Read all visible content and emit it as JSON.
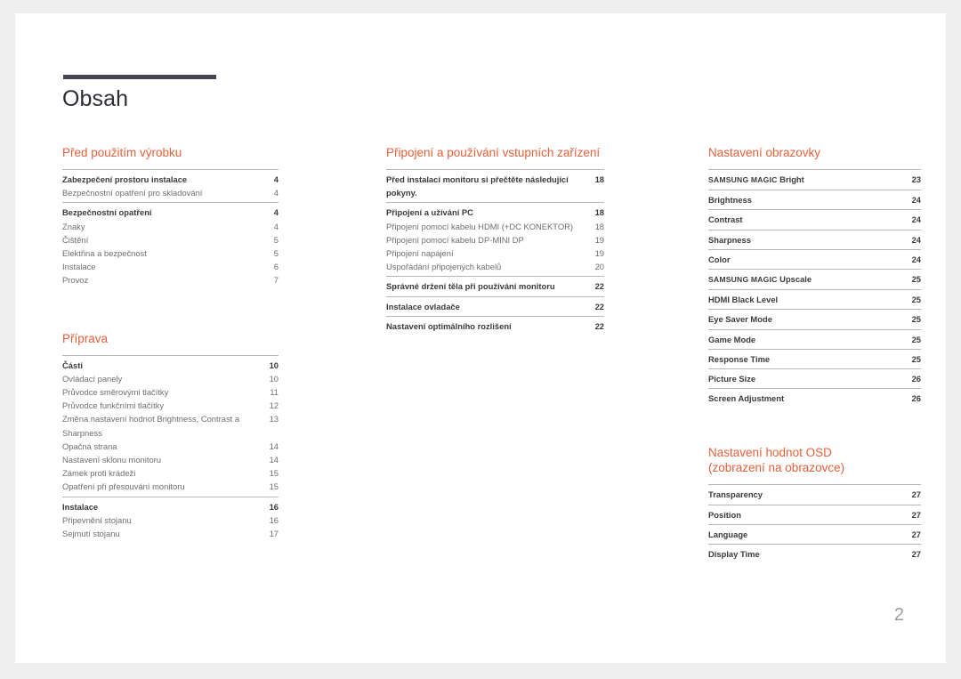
{
  "document": {
    "title": "Obsah",
    "page_number": "2",
    "accent_color": "#e4603c",
    "title_rule_color": "#474451"
  },
  "columns": [
    {
      "name": "column-left",
      "sections": [
        {
          "heading": "Před použitím výrobku",
          "groups": [
            {
              "entries": [
                {
                  "label": "Zabezpečení prostoru instalace",
                  "page": "4",
                  "level": "main"
                },
                {
                  "label": "Bezpečnostní opatření pro skladování",
                  "page": "4",
                  "level": "sub"
                }
              ]
            },
            {
              "entries": [
                {
                  "label": "Bezpečnostní opatření",
                  "page": "4",
                  "level": "main"
                },
                {
                  "label": "Znaky",
                  "page": "4",
                  "level": "sub"
                },
                {
                  "label": "Čištění",
                  "page": "5",
                  "level": "sub"
                },
                {
                  "label": "Elektřina a bezpečnost",
                  "page": "5",
                  "level": "sub"
                },
                {
                  "label": "Instalace",
                  "page": "6",
                  "level": "sub"
                },
                {
                  "label": "Provoz",
                  "page": "7",
                  "level": "sub"
                }
              ]
            }
          ]
        },
        {
          "heading": "Příprava",
          "groups": [
            {
              "entries": [
                {
                  "label": "Části",
                  "page": "10",
                  "level": "main"
                },
                {
                  "label": "Ovládací panely",
                  "page": "10",
                  "level": "sub"
                },
                {
                  "label": "Průvodce směrovými tlačítky",
                  "page": "11",
                  "level": "sub"
                },
                {
                  "label": "Průvodce funkčními tlačítky",
                  "page": "12",
                  "level": "sub"
                },
                {
                  "label": "Změna nastavení hodnot Brightness, Contrast a Sharpness",
                  "page": "13",
                  "level": "sub"
                },
                {
                  "label": "Opačná strana",
                  "page": "14",
                  "level": "sub"
                },
                {
                  "label": "Nastavení sklonu monitoru",
                  "page": "14",
                  "level": "sub"
                },
                {
                  "label": "Zámek proti krádeži",
                  "page": "15",
                  "level": "sub"
                },
                {
                  "label": "Opatření při přesouvání monitoru",
                  "page": "15",
                  "level": "sub"
                }
              ]
            },
            {
              "entries": [
                {
                  "label": "Instalace",
                  "page": "16",
                  "level": "main"
                },
                {
                  "label": "Připevnění stojanu",
                  "page": "16",
                  "level": "sub"
                },
                {
                  "label": "Sejmutí stojanu",
                  "page": "17",
                  "level": "sub"
                }
              ]
            }
          ]
        }
      ]
    },
    {
      "name": "column-middle",
      "sections": [
        {
          "heading": "Připojení a používání vstupních zařízení",
          "groups": [
            {
              "entries": [
                {
                  "label": "Před instalací monitoru si přečtěte následující pokyny.",
                  "page": "18",
                  "level": "main"
                }
              ]
            },
            {
              "entries": [
                {
                  "label": "Připojení a užívání PC",
                  "page": "18",
                  "level": "main"
                },
                {
                  "label": "Připojení pomocí kabelu HDMI (+DC KONEKTOR)",
                  "page": "18",
                  "level": "sub"
                },
                {
                  "label": "Připojení pomocí kabelu DP-MINI DP",
                  "page": "19",
                  "level": "sub"
                },
                {
                  "label": "Připojení napájení",
                  "page": "19",
                  "level": "sub"
                },
                {
                  "label": "Uspořádání připojených kabelů",
                  "page": "20",
                  "level": "sub"
                }
              ]
            },
            {
              "entries": [
                {
                  "label": "Správné držení těla při používání monitoru",
                  "page": "22",
                  "level": "main"
                }
              ]
            },
            {
              "entries": [
                {
                  "label": "Instalace ovladače",
                  "page": "22",
                  "level": "main"
                }
              ]
            },
            {
              "entries": [
                {
                  "label": "Nastavení optimálního rozlišení",
                  "page": "22",
                  "level": "main"
                }
              ]
            }
          ]
        }
      ]
    },
    {
      "name": "column-right",
      "sections": [
        {
          "heading": "Nastavení obrazovky",
          "groups": [
            {
              "entries": [
                {
                  "label": "SAMSUNG MAGIC Bright",
                  "page": "23",
                  "level": "main"
                }
              ]
            },
            {
              "entries": [
                {
                  "label": "Brightness",
                  "page": "24",
                  "level": "main"
                }
              ]
            },
            {
              "entries": [
                {
                  "label": "Contrast",
                  "page": "24",
                  "level": "main"
                }
              ]
            },
            {
              "entries": [
                {
                  "label": "Sharpness",
                  "page": "24",
                  "level": "main"
                }
              ]
            },
            {
              "entries": [
                {
                  "label": "Color",
                  "page": "24",
                  "level": "main"
                }
              ]
            },
            {
              "entries": [
                {
                  "label": "SAMSUNG MAGIC Upscale",
                  "page": "25",
                  "level": "main"
                }
              ]
            },
            {
              "entries": [
                {
                  "label": "HDMI Black Level",
                  "page": "25",
                  "level": "main"
                }
              ]
            },
            {
              "entries": [
                {
                  "label": "Eye Saver Mode",
                  "page": "25",
                  "level": "main"
                }
              ]
            },
            {
              "entries": [
                {
                  "label": "Game Mode",
                  "page": "25",
                  "level": "main"
                }
              ]
            },
            {
              "entries": [
                {
                  "label": "Response Time",
                  "page": "25",
                  "level": "main"
                }
              ]
            },
            {
              "entries": [
                {
                  "label": "Picture Size",
                  "page": "26",
                  "level": "main"
                }
              ]
            },
            {
              "entries": [
                {
                  "label": "Screen Adjustment",
                  "page": "26",
                  "level": "main"
                }
              ]
            }
          ]
        },
        {
          "heading": "Nastavení hodnot OSD\n(zobrazení na obrazovce)",
          "groups": [
            {
              "entries": [
                {
                  "label": "Transparency",
                  "page": "27",
                  "level": "main"
                }
              ]
            },
            {
              "entries": [
                {
                  "label": "Position",
                  "page": "27",
                  "level": "main"
                }
              ]
            },
            {
              "entries": [
                {
                  "label": "Language",
                  "page": "27",
                  "level": "main"
                }
              ]
            },
            {
              "entries": [
                {
                  "label": "Display Time",
                  "page": "27",
                  "level": "main"
                }
              ]
            }
          ]
        }
      ]
    }
  ]
}
